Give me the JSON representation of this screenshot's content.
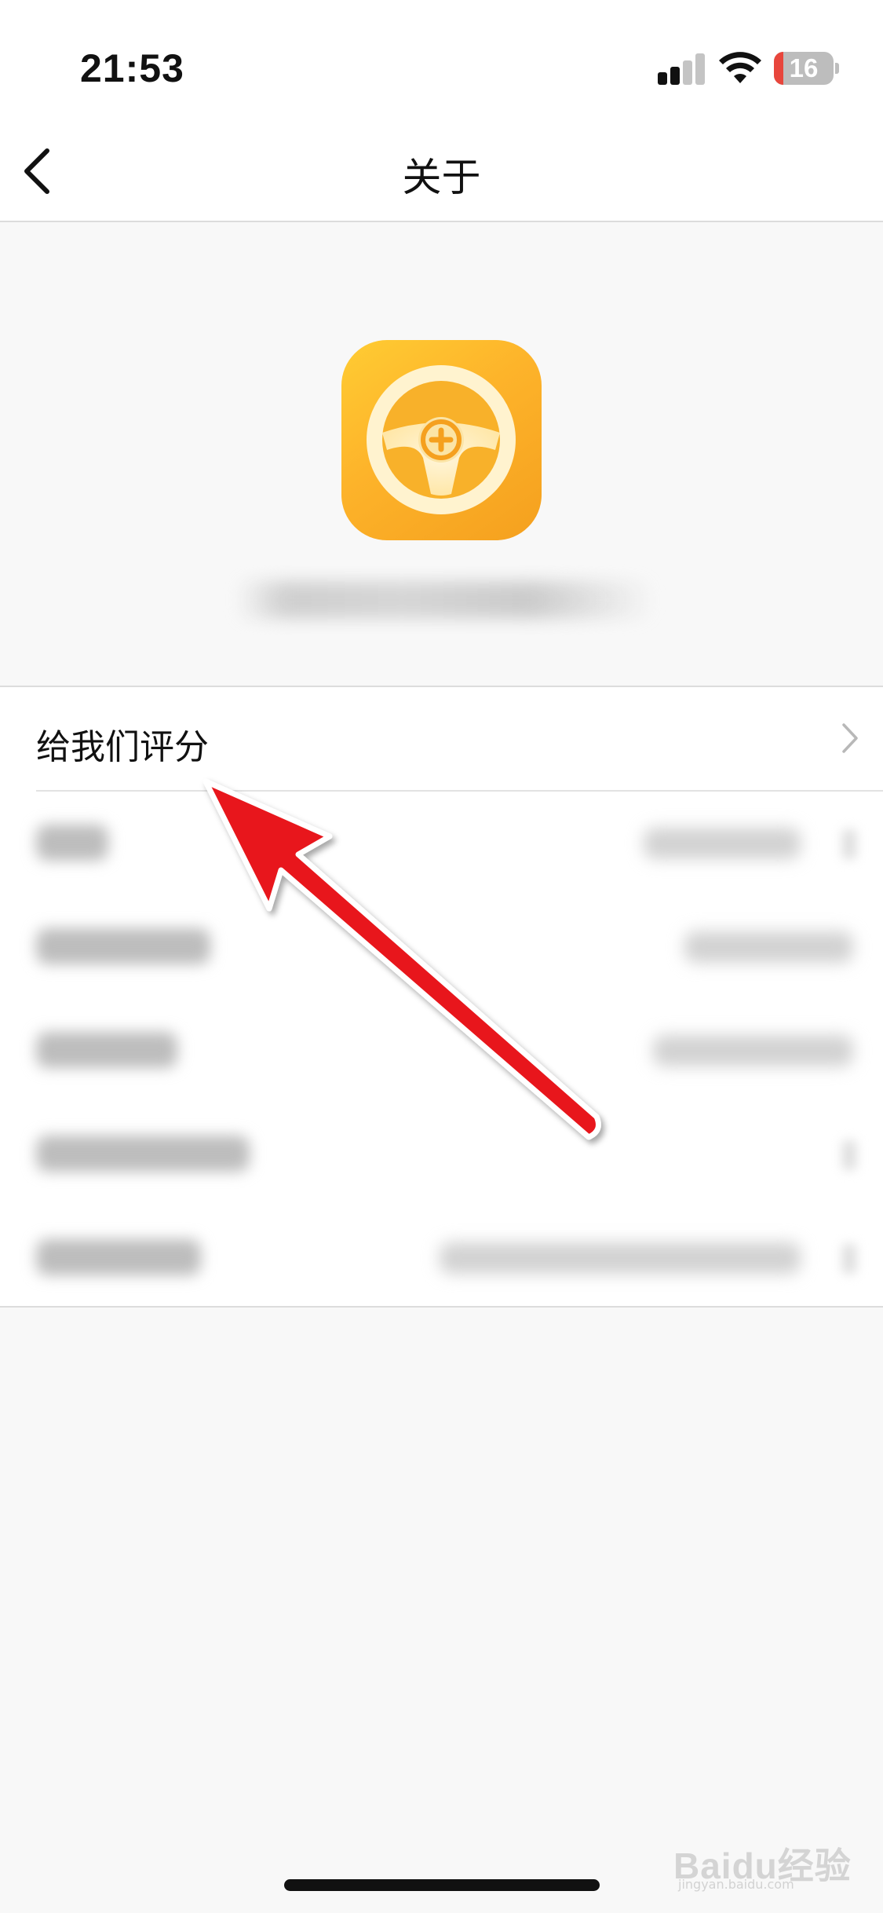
{
  "status_bar": {
    "time": "21:53",
    "battery_level": "16",
    "icons": [
      "signal-icon",
      "wifi-icon",
      "battery-icon"
    ]
  },
  "nav": {
    "title": "关于",
    "back_icon": "chevron-left-icon"
  },
  "app": {
    "icon": "steering-wheel-plus-icon"
  },
  "settings": {
    "rate_us_label": "给我们评分",
    "chevron_icon": "chevron-right-icon"
  },
  "watermark": {
    "text": "Baidu经验",
    "sub": "jingyan.baidu.com"
  },
  "colors": {
    "app_icon_orange": "#fdb32a",
    "annotation_arrow": "#e8141b",
    "battery_low": "#e8463c"
  }
}
